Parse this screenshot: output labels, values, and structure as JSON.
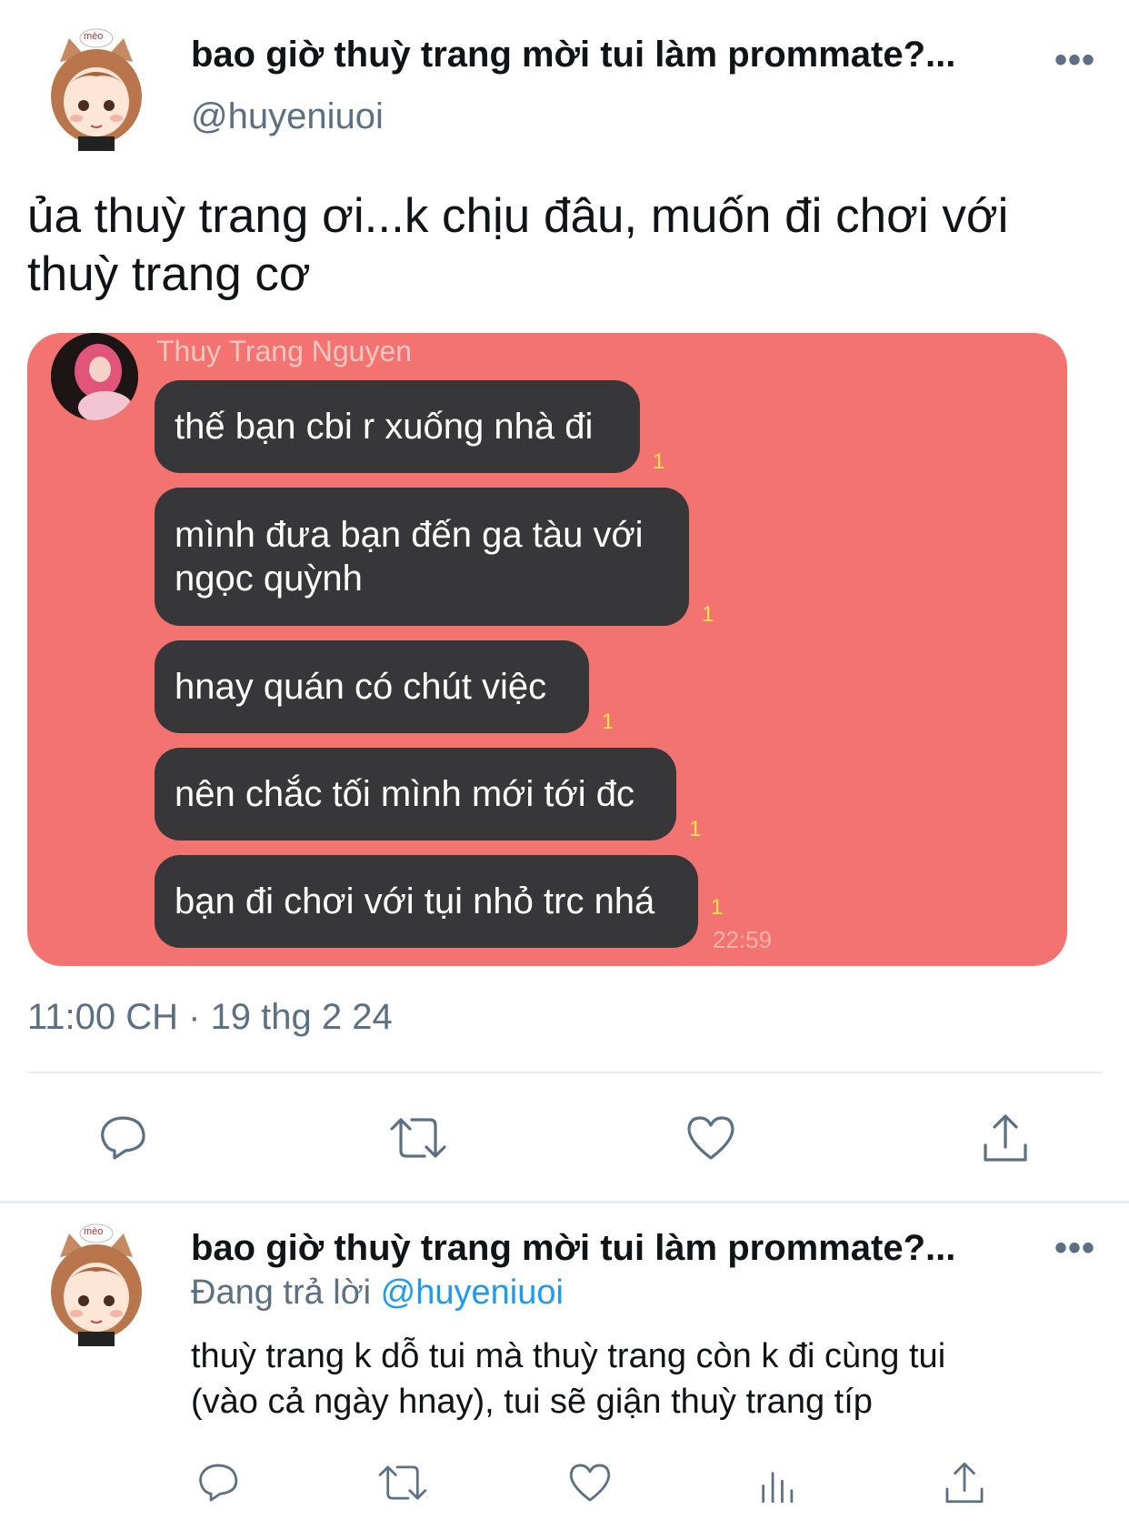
{
  "tweet": {
    "display_name": "bao giờ thuỳ trang mời tui làm prommate?...",
    "handle": "@huyeniuoi",
    "more_icon": "more-horizontal-icon",
    "avatar_label": "mèo",
    "text_line1": "ủa thuỳ trang ơi...k chịu đâu, muốn đi chơi với",
    "text_line2": "thuỳ trang cơ",
    "timestamp": "11:00 CH · 19 thg 2 24",
    "actions": [
      "reply-icon",
      "retweet-icon",
      "like-icon",
      "share-icon"
    ]
  },
  "chat_image": {
    "sender": "Thuy Trang Nguyen",
    "messages": [
      {
        "lines": [
          "thế bạn cbi r xuống nhà đi"
        ],
        "read": "1"
      },
      {
        "lines": [
          "mình đưa bạn đến ga tàu với",
          "ngọc quỳnh"
        ],
        "read": "1"
      },
      {
        "lines": [
          "hnay quán có chút việc"
        ],
        "read": "1"
      },
      {
        "lines": [
          "nên chắc tối mình mới tới đc"
        ],
        "read": "1"
      },
      {
        "lines": [
          "bạn đi chơi với tụi nhỏ trc nhá"
        ],
        "read": "1"
      }
    ],
    "time": "22:59",
    "colors": {
      "background": "#f2736f",
      "bubble": "#373638",
      "read_count": "#ffe34d"
    }
  },
  "reply": {
    "display_name": "bao giờ thuỳ trang mời tui làm prommate?...",
    "replying_prefix": "Đang trả lời",
    "replying_to": "@huyeniuoi",
    "avatar_label": "mèo",
    "text_line1": "thuỳ trang k dỗ tui mà thuỳ trang còn k đi cùng tui",
    "text_line2": "(vào cả ngày hnay), tui sẽ giận thuỳ trang típ",
    "actions": [
      "reply-icon",
      "retweet-icon",
      "like-icon",
      "analytics-icon",
      "share-icon"
    ]
  }
}
